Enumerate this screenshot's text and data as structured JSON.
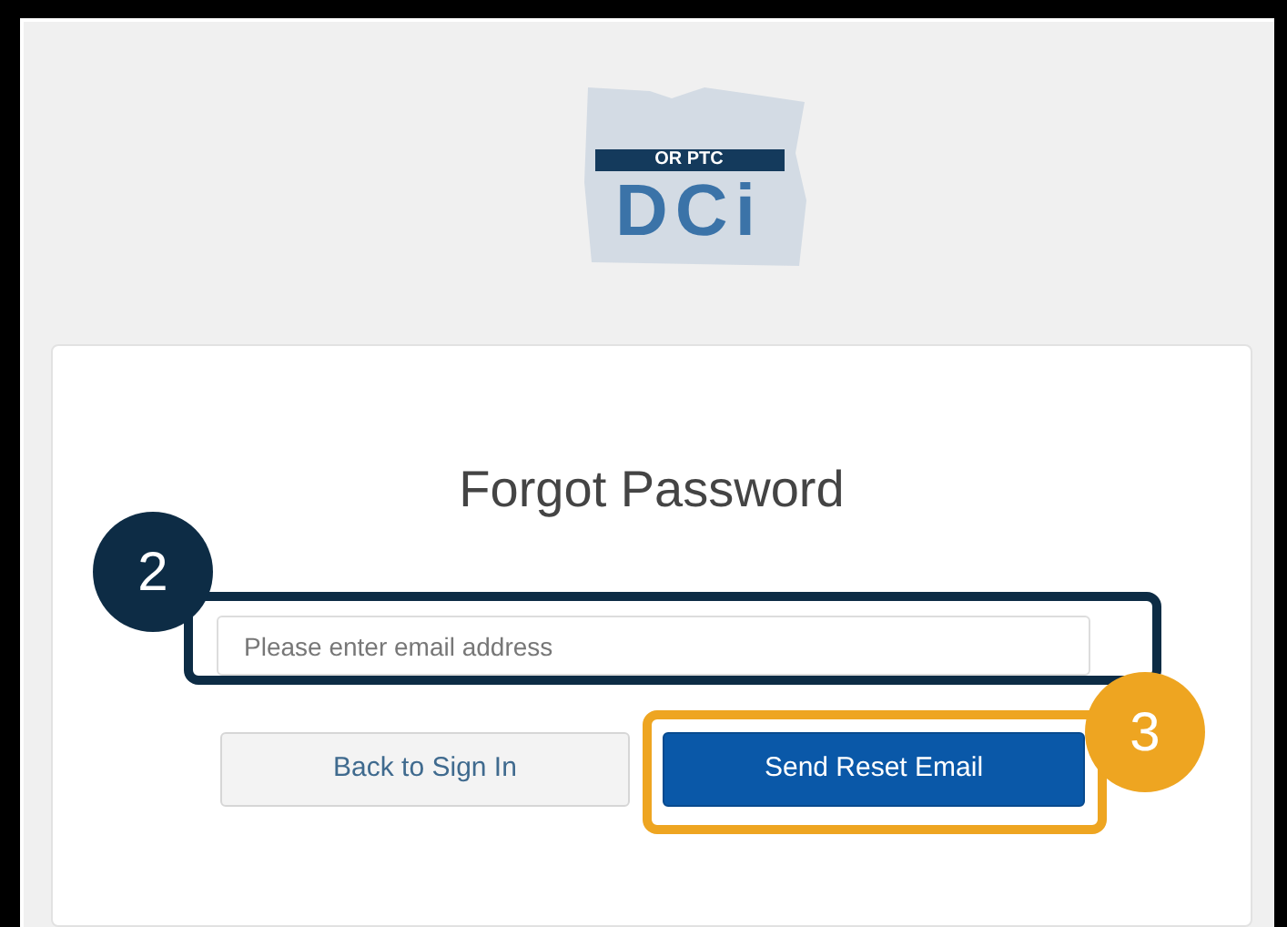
{
  "logo": {
    "banner": "OR PTC",
    "letters": "DCi"
  },
  "form": {
    "title": "Forgot Password",
    "email": {
      "placeholder": "Please enter email address"
    },
    "buttons": [
      {
        "label": "Back to Sign In",
        "kind": "secondary"
      },
      {
        "label": "Send Reset Email",
        "kind": "primary"
      }
    ]
  },
  "callouts": [
    {
      "number": "2",
      "color": "#0d2c45"
    },
    {
      "number": "3",
      "color": "#eea521"
    }
  ]
}
